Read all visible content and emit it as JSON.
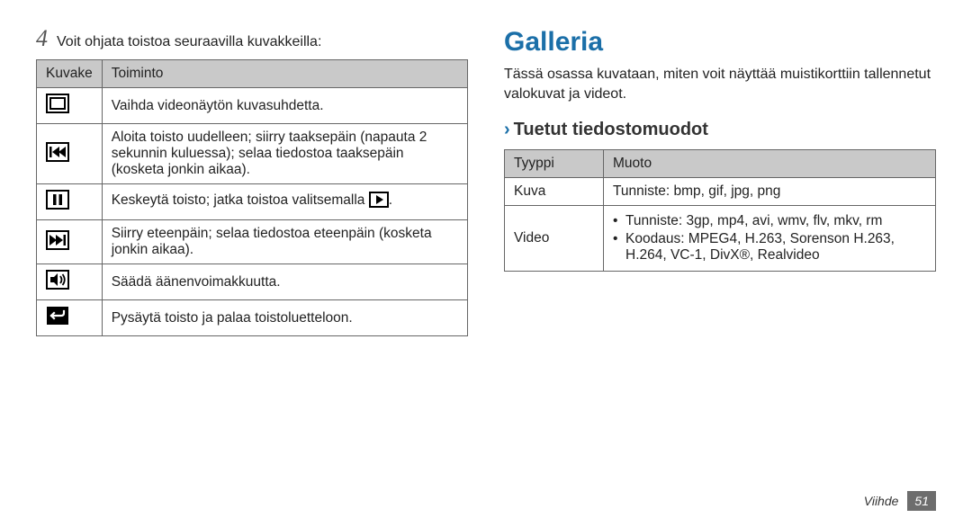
{
  "left": {
    "step_number": "4",
    "step_text": "Voit ohjata toistoa seuraavilla kuvakkeilla:",
    "headers": {
      "icon": "Kuvake",
      "func": "Toiminto"
    },
    "rows": [
      {
        "icon": "aspect-ratio",
        "text": "Vaihda videonäytön kuvasuhdetta."
      },
      {
        "icon": "skip-back",
        "text": "Aloita toisto uudelleen; siirry taaksepäin (napauta 2 sekunnin kuluessa); selaa tiedostoa taaksepäin (kosketa jonkin aikaa)."
      },
      {
        "icon": "pause",
        "text_before": "Keskeytä toisto; jatka toistoa valitsemalla ",
        "text_after": "."
      },
      {
        "icon": "skip-fwd",
        "text": "Siirry eteenpäin; selaa tiedostoa eteenpäin (kosketa jonkin aikaa)."
      },
      {
        "icon": "volume",
        "text": "Säädä äänenvoimakkuutta."
      },
      {
        "icon": "back",
        "text": "Pysäytä toisto ja palaa toistoluetteloon."
      }
    ]
  },
  "right": {
    "title": "Galleria",
    "intro": "Tässä osassa kuvataan, miten voit näyttää muistikorttiin tallennetut valokuvat ja videot.",
    "sub_chevron": "›",
    "sub_title": "Tuetut tiedostomuodot",
    "headers": {
      "type": "Tyyppi",
      "format": "Muoto"
    },
    "rows": {
      "image": {
        "type": "Kuva",
        "format": "Tunniste: bmp, gif, jpg, png"
      },
      "video": {
        "type": "Video",
        "bullets": [
          "Tunniste: 3gp, mp4, avi, wmv, flv, mkv, rm",
          "Koodaus: MPEG4, H.263, Sorenson H.263, H.264, VC-1, DivX®, Realvideo"
        ]
      }
    }
  },
  "footer": {
    "section": "Viihde",
    "page": "51"
  }
}
